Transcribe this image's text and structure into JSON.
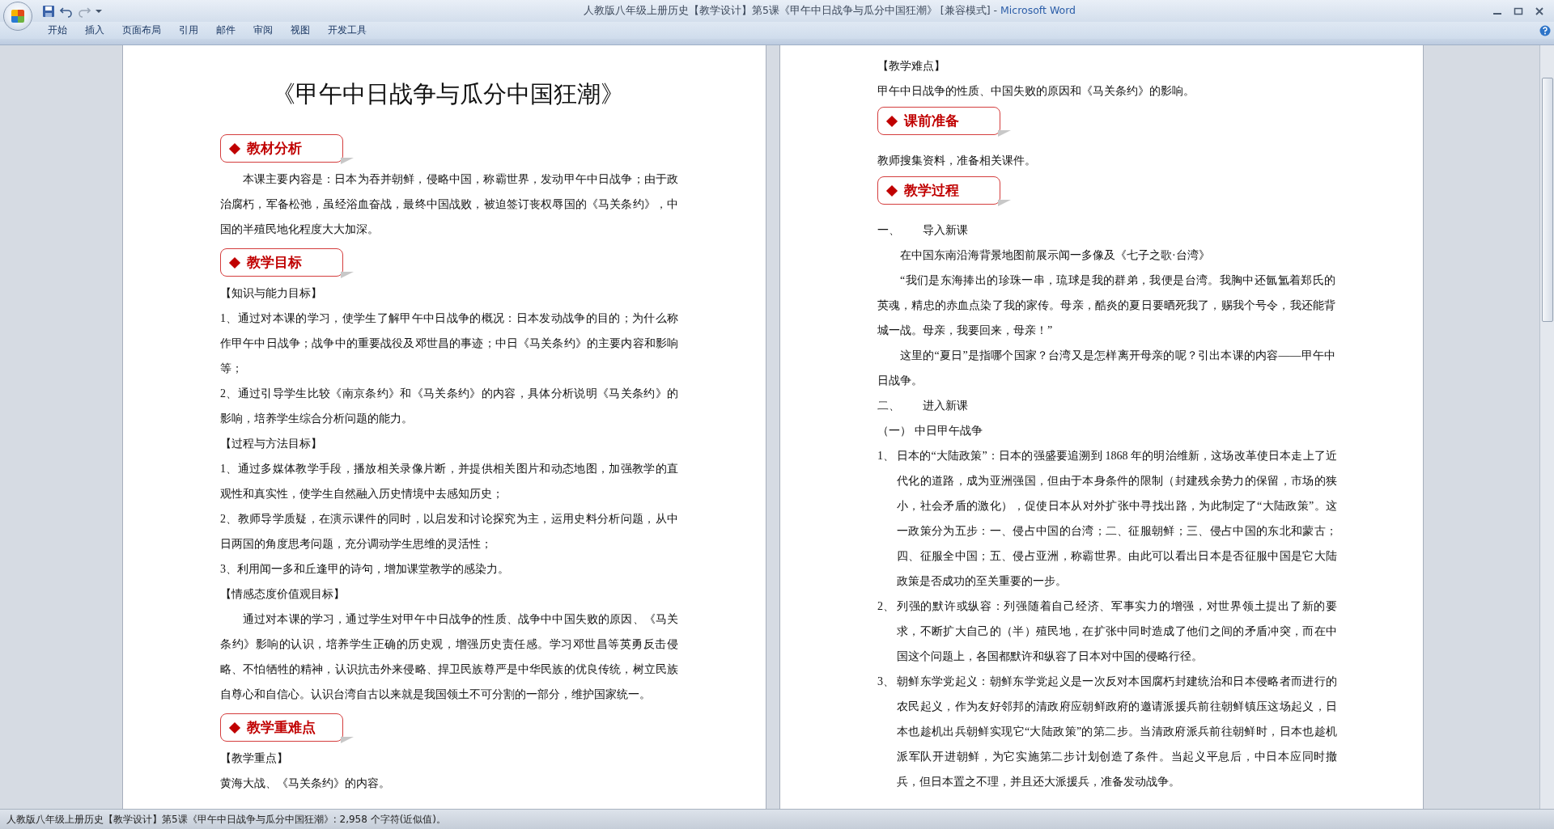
{
  "window": {
    "title": "人教版八年级上册历史【教学设计】第5课《甲午中日战争与瓜分中国狂潮》 [兼容模式] - ",
    "app_name": "Microsoft Word"
  },
  "tabs": [
    {
      "label": "开始",
      "selected": false
    },
    {
      "label": "插入",
      "selected": false
    },
    {
      "label": "页面布局",
      "selected": false
    },
    {
      "label": "引用",
      "selected": false
    },
    {
      "label": "邮件",
      "selected": false
    },
    {
      "label": "审阅",
      "selected": false
    },
    {
      "label": "视图",
      "selected": false
    },
    {
      "label": "开发工具",
      "selected": false
    }
  ],
  "pages": [
    {
      "blocks": [
        {
          "kind": "title",
          "text": "《甲午中日战争与瓜分中国狂潮》"
        },
        {
          "kind": "heading",
          "text": "教材分析"
        },
        {
          "kind": "indent",
          "text": "本课主要内容是：日本为吞并朝鲜，侵略中国，称霸世界，发动甲午中日战争；由于政治腐朽，军备松弛，虽经浴血奋战，最终中国战败，被迫签订丧权辱国的《马关条约》，中国的半殖民地化程度大大加深。"
        },
        {
          "kind": "heading",
          "text": "教学目标"
        },
        {
          "kind": "para",
          "text": "【知识与能力目标】"
        },
        {
          "kind": "para",
          "text": "1、通过对本课的学习，使学生了解甲午中日战争的概况：日本发动战争的目的；为什么称作甲午中日战争；战争中的重要战役及邓世昌的事迹；中日《马关条约》的主要内容和影响等；"
        },
        {
          "kind": "para",
          "text": "2、通过引导学生比较《南京条约》和《马关条约》的内容，具体分析说明《马关条约》的影响，培养学生综合分析问题的能力。"
        },
        {
          "kind": "para",
          "text": "【过程与方法目标】"
        },
        {
          "kind": "para",
          "text": "1、通过多媒体教学手段，播放相关录像片断，并提供相关图片和动态地图，加强教学的直观性和真实性，使学生自然融入历史情境中去感知历史；"
        },
        {
          "kind": "para",
          "text": "2、教师导学质疑，在演示课件的同时，以启发和讨论探究为主，运用史料分析问题，从中日两国的角度思考问题，充分调动学生思维的灵活性；"
        },
        {
          "kind": "para",
          "text": "3、利用闻一多和丘逢甲的诗句，增加课堂教学的感染力。"
        },
        {
          "kind": "para",
          "text": "【情感态度价值观目标】"
        },
        {
          "kind": "indent",
          "text": "通过对本课的学习，通过学生对甲午中日战争的性质、战争中中国失败的原因、《马关条约》影响的认识，培养学生正确的历史观，增强历史责任感。学习邓世昌等英勇反击侵略、不怕牺牲的精神，认识抗击外来侵略、捍卫民族尊严是中华民族的优良传统，树立民族自尊心和自信心。认识台湾自古以来就是我国领土不可分割的一部分，维护国家统一。"
        },
        {
          "kind": "heading",
          "text": "教学重难点"
        },
        {
          "kind": "para",
          "text": "【教学重点】"
        },
        {
          "kind": "para",
          "text": "黄海大战、《马关条约》的内容。"
        }
      ]
    },
    {
      "blocks": [
        {
          "kind": "para",
          "text": "【教学难点】"
        },
        {
          "kind": "para",
          "text": "甲午中日战争的性质、中国失败的原因和《马关条约》的影响。"
        },
        {
          "kind": "heading",
          "text": "课前准备"
        },
        {
          "kind": "para",
          "text": "教师搜集资料，准备相关课件。"
        },
        {
          "kind": "heading",
          "text": "教学过程"
        },
        {
          "kind": "outline",
          "num": "一、",
          "text": "导入新课"
        },
        {
          "kind": "indent",
          "text": "在中国东南沿海背景地图前展示闻一多像及《七子之歌·台湾》"
        },
        {
          "kind": "indent",
          "text": "“我们是东海捧出的珍珠一串，琉球是我的群弟，我便是台湾。我胸中还氤氲着郑氏的英魂，精忠的赤血点染了我的家传。母亲，酷炎的夏日要晒死我了，赐我个号令，我还能背城一战。母亲，我要回来，母亲！”"
        },
        {
          "kind": "indent",
          "text": "这里的“夏日”是指哪个国家？台湾又是怎样离开母亲的呢？引出本课的内容——甲午中日战争。"
        },
        {
          "kind": "outline",
          "num": "二、",
          "text": "进入新课"
        },
        {
          "kind": "para",
          "text": "（一） 中日甲午战争"
        },
        {
          "kind": "numbered",
          "num": "1、",
          "text": "日本的“大陆政策”：日本的强盛要追溯到 1868 年的明治维新，这场改革使日本走上了近代化的道路，成为亚洲强国，但由于本身条件的限制（封建残余势力的保留，市场的狭小，社会矛盾的激化），促使日本从对外扩张中寻找出路，为此制定了“大陆政策”。这一政策分为五步：一、侵占中国的台湾；二、征服朝鲜；三、侵占中国的东北和蒙古；四、征服全中国；五、侵占亚洲，称霸世界。由此可以看出日本是否征服中国是它大陆政策是否成功的至关重要的一步。"
        },
        {
          "kind": "numbered",
          "num": "2、",
          "text": "列强的默许或纵容：列强随着自己经济、军事实力的增强，对世界领土提出了新的要求，不断扩大自己的（半）殖民地，在扩张中同时造成了他们之间的矛盾冲突，而在中国这个问题上，各国都默许和纵容了日本对中国的侵略行径。"
        },
        {
          "kind": "numbered",
          "num": "3、",
          "text": "朝鲜东学党起义：朝鲜东学党起义是一次反对本国腐朽封建统治和日本侵略者而进行的农民起义，作为友好邻邦的清政府应朝鲜政府的邀请派援兵前往朝鲜镇压这场起义，日本也趁机出兵朝鲜实现它“大陆政策”的第二步。当清政府派兵前往朝鲜时，日本也趁机派军队开进朝鲜，为它实施第二步计划创造了条件。当起义平息后，中日本应同时撤兵，但日本置之不理，并且还大派援兵，准备发动战争。"
        }
      ]
    }
  ],
  "status_bar": {
    "text": "人教版八年级上册历史【教学设计】第5课《甲午中日战争与瓜分中国狂潮》: 2,958 个字符(近似值)。"
  }
}
